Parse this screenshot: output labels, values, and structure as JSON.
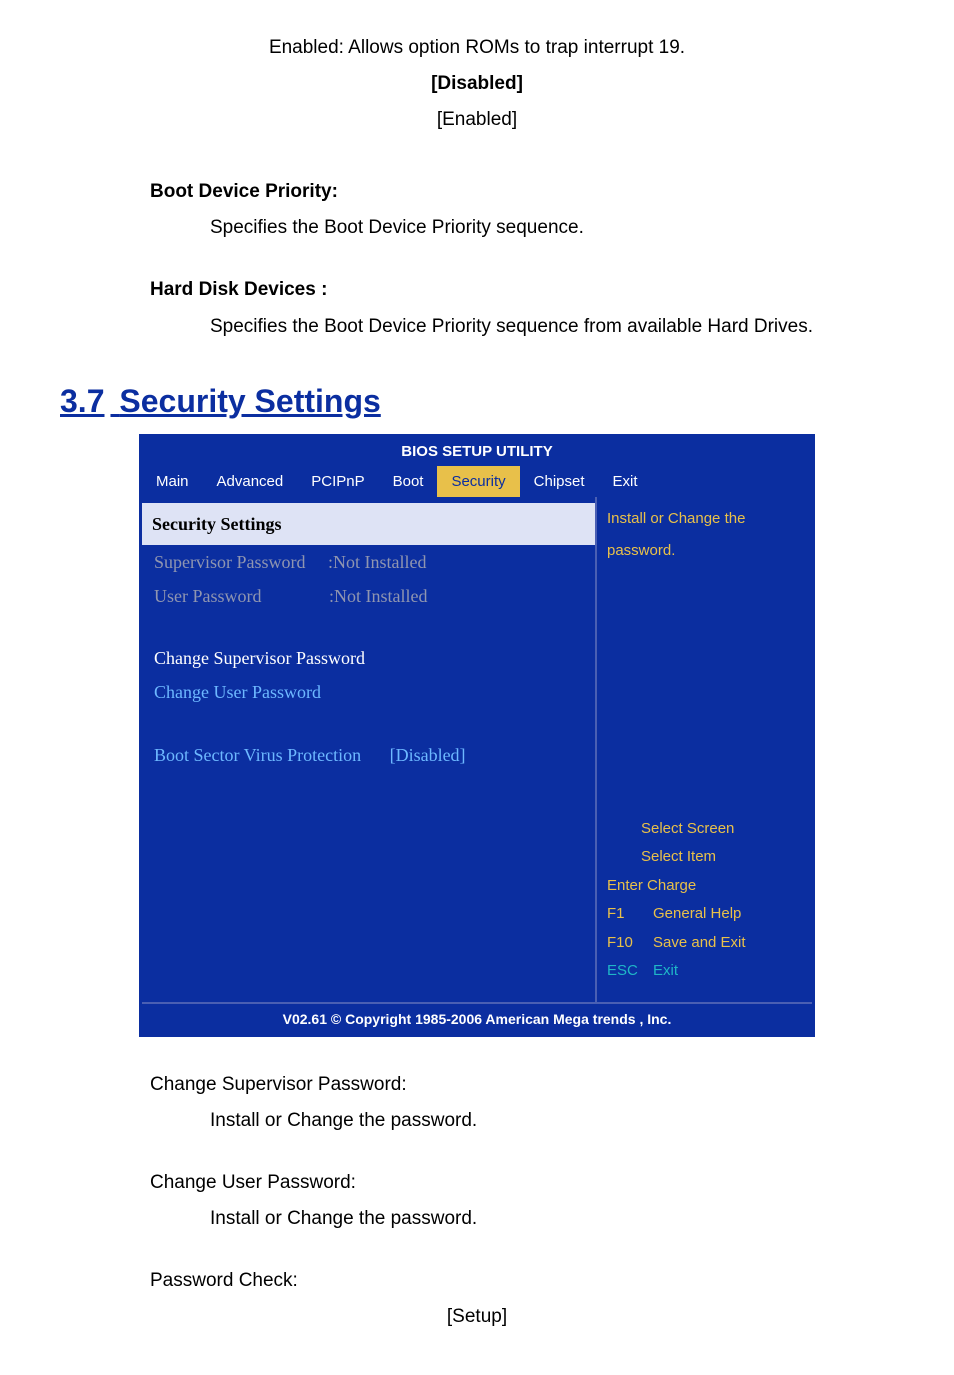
{
  "top": {
    "enabled_desc": "Enabled: Allows option ROMs to trap interrupt 19.",
    "disabled_bold": "[Disabled]",
    "enabled_center": "[Enabled]"
  },
  "boot_device": {
    "heading": "Boot Device Priority:",
    "body": "Specifies the Boot Device Priority sequence."
  },
  "hard_disk": {
    "heading": "Hard Disk Devices :",
    "body": "Specifies the Boot Device Priority sequence from available Hard Drives."
  },
  "section": {
    "num": "3.7",
    "title": "Security Settings"
  },
  "bios": {
    "title": "BIOS SETUP UTILITY",
    "tabs": [
      "Main",
      "Advanced",
      "PCIPnP",
      "Boot",
      "Security",
      "Chipset",
      "Exit"
    ],
    "active_tab_index": 4,
    "left": {
      "section_title": "Security Settings",
      "sup_label": "Supervisor Password",
      "sup_val": ":Not Installed",
      "user_label": "User Password",
      "user_val": ":Not Installed",
      "change_sup": "Change Supervisor Password",
      "change_user": "Change User Password",
      "bsvp_label": "Boot Sector Virus Protection",
      "bsvp_val": "[Disabled]"
    },
    "right": {
      "help1": "Install or Change the",
      "help2": "password.",
      "select_screen": "Select Screen",
      "select_item": "Select Item",
      "enter_charge": "Enter Charge",
      "f1": "F1",
      "general_help": "General Help",
      "f10": "F10",
      "save_exit": "Save and Exit",
      "esc": "ESC",
      "exit": "Exit"
    },
    "footer": "V02.61 © Copyright 1985-2006 American Mega trends , Inc."
  },
  "below": {
    "csup_h": "Change Supervisor Password:",
    "csup_b": "Install or Change the password.",
    "cusr_h": "Change User Password:",
    "cusr_b": "Install or Change the password.",
    "pchk_h": "Password Check:",
    "pchk_v": "[Setup]"
  }
}
